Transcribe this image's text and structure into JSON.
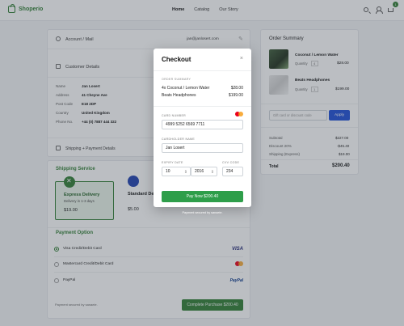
{
  "nav": {
    "brand": "Shoperio",
    "links": [
      "Home",
      "Catalog",
      "Our Story"
    ],
    "cart_count": "1",
    "brand_color": "#2e7d32"
  },
  "account": {
    "label": "Account / Mail",
    "email": "jan@janlosert.com"
  },
  "customer": {
    "title": "Customer Details",
    "fields": [
      {
        "k": "Name",
        "v": "Jan Losert"
      },
      {
        "k": "Address",
        "v": "41 Cheyne Ave"
      },
      {
        "k": "Post Code",
        "v": "E18 2DP"
      },
      {
        "k": "Country",
        "v": "United Kingdom"
      },
      {
        "k": "Phone No.",
        "v": "+44 (0) 7887 444 322"
      }
    ]
  },
  "shipping_payment": {
    "label": "Shipping + Payment Details"
  },
  "shipping_service": {
    "title": "Shipping Service",
    "express": {
      "name": "Express Delivery",
      "desc": "Delivery in 1-3 days",
      "price": "$19.00"
    },
    "standard": {
      "name": "Standard Del...",
      "price": "$5.00"
    }
  },
  "payment_option": {
    "title": "Payment Option",
    "options": [
      {
        "label": "Visa Credit/Debit Card",
        "brand": "VISA"
      },
      {
        "label": "Mastercard Credit/Debit Card",
        "brand": "mastercard"
      },
      {
        "label": "PayPal",
        "brand": "PayPal"
      }
    ],
    "secure_note": "Payment secured by sanaeie.",
    "complete_button": "Complete Purchase $200.40"
  },
  "order_summary": {
    "title": "Order Summary",
    "items": [
      {
        "name": "Coconut / Lemon Water",
        "qty_label": "Quantity",
        "qty": "4",
        "price": "$28.00"
      },
      {
        "name": "Beats Headphones",
        "qty_label": "Quantity",
        "qty": "1",
        "price": "$199.00"
      }
    ],
    "discount_placeholder": "Gift card or discount code",
    "apply_label": "Apply",
    "totals": [
      {
        "k": "Subtotal",
        "v": "$227.00"
      },
      {
        "k": "Discount 20%",
        "v": "-$45.40"
      },
      {
        "k": "Shipping (Express)",
        "v": "$19.00"
      }
    ],
    "total_label": "Total",
    "total_value": "$200.40"
  },
  "modal": {
    "title": "Checkout",
    "close": "×",
    "summary_caption": "ORDER SUMMARY",
    "items": [
      {
        "name": "4x Coconut / Lemon Water",
        "price": "$28.00"
      },
      {
        "name": "Beats Headphones",
        "price": "$199.00"
      }
    ],
    "card_number_label": "CARD NUMBER",
    "card_number": "4999 5252 6569 7711",
    "cardholder_label": "CARDHOLDER NAME",
    "cardholder": "Jan Losert",
    "expiry_label": "EXPIRY DATE",
    "expiry_month": "10",
    "expiry_year": "2016",
    "cvv_label": "CVV CODE",
    "cvv": "234",
    "pay_button": "Pay Now $200.40",
    "secure_note": "Payment secured by sanaeie."
  }
}
